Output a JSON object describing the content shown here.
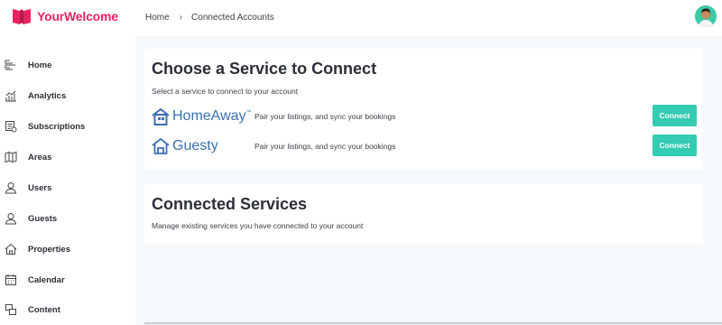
{
  "app": {
    "name": "YourWelcome",
    "brand_color": "#e8245f",
    "accent_color": "#33cbb1"
  },
  "breadcrumb": {
    "home": "Home",
    "separator": "›",
    "current": "Connected Accounts"
  },
  "sidebar": {
    "items": [
      {
        "label": "Home",
        "icon": "home-icon"
      },
      {
        "label": "Analytics",
        "icon": "analytics-icon"
      },
      {
        "label": "Subscriptions",
        "icon": "subscriptions-icon"
      },
      {
        "label": "Areas",
        "icon": "map-icon"
      },
      {
        "label": "Users",
        "icon": "user-icon"
      },
      {
        "label": "Guests",
        "icon": "guest-icon"
      },
      {
        "label": "Properties",
        "icon": "house-icon"
      },
      {
        "label": "Calendar",
        "icon": "calendar-icon"
      },
      {
        "label": "Content",
        "icon": "content-icon"
      }
    ]
  },
  "choose": {
    "title": "Choose a Service to Connect",
    "subtitle": "Select a service to connect to your account",
    "services": [
      {
        "name": "HomeAway",
        "mark": "™",
        "description": "Pair your listings, and sync your bookings",
        "button": "Connect"
      },
      {
        "name": "Guesty",
        "mark": "",
        "description": "Pair your listings, and sync your bookings",
        "button": "Connect"
      }
    ]
  },
  "connected": {
    "title": "Connected Services",
    "subtitle": "Manage existing services you have connected to your account"
  }
}
